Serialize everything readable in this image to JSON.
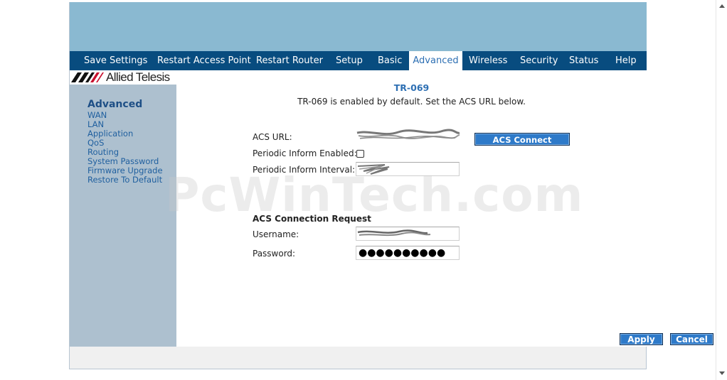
{
  "nav": {
    "items": [
      {
        "label": "Save Settings"
      },
      {
        "label": "Restart Access Point"
      },
      {
        "label": "Restart Router"
      },
      {
        "label": "Setup"
      },
      {
        "label": "Basic"
      },
      {
        "label": "Advanced",
        "active": true
      },
      {
        "label": "Wireless"
      },
      {
        "label": "Security"
      },
      {
        "label": "Status"
      },
      {
        "label": "Help"
      }
    ]
  },
  "brand": {
    "logo_text": "Allied Telesis"
  },
  "sidebar": {
    "title": "Advanced",
    "links": [
      {
        "label": "WAN"
      },
      {
        "label": "LAN"
      },
      {
        "label": "Application"
      },
      {
        "label": "QoS"
      },
      {
        "label": "Routing"
      },
      {
        "label": "System Password"
      },
      {
        "label": "Firmware Upgrade"
      },
      {
        "label": "Restore To Default"
      }
    ]
  },
  "main": {
    "title": "TR-069",
    "description": "TR-069 is enabled by default. Set the ACS URL below.",
    "acs_url_label": "ACS URL:",
    "acs_connect_label": "ACS Connect",
    "periodic_enabled_label": "Periodic Inform Enabled:",
    "periodic_enabled_checked": false,
    "periodic_interval_label": "Periodic Inform Interval:",
    "section_title": "ACS Connection Request",
    "username_label": "Username:",
    "password_label": "Password:",
    "password_masked": "●●●●●●●●●●",
    "apply_label": "Apply",
    "cancel_label": "Cancel"
  },
  "watermark": "PcWinTech.com",
  "colors": {
    "banner": "#8ab9d1",
    "navbar": "#084c7f",
    "sidebar": "#adc0cf",
    "accent": "#2d6fb3",
    "button": "#2e7ac9"
  }
}
